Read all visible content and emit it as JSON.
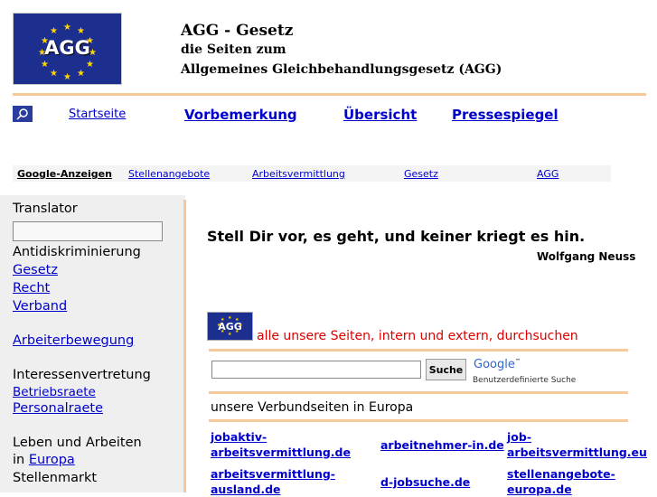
{
  "header": {
    "logo_text": "AGG",
    "title": "AGG - Gesetz",
    "subtitle1": "die Seiten zum",
    "subtitle2": "Allgemeines Gleichbehandlungsgesetz (AGG)"
  },
  "nav": {
    "home": "Startseite",
    "items": [
      "Vorbemerkung",
      "Übersicht",
      "Pressespiegel"
    ]
  },
  "ads": {
    "label": "Google-Anzeigen",
    "links": [
      "Stellenangebote",
      "Arbeitsvermittlung",
      "Gesetz",
      "AGG"
    ]
  },
  "sidebar": {
    "translator": "Translator",
    "antidisk": "Antidiskriminierung",
    "gesetz": "Gesetz",
    "recht": "Recht",
    "verband": "Verband",
    "arbeiter": "Arbeiterbewegung",
    "interessen": "Interessenvertretung",
    "betriebsraete": "Betriebsraete",
    "personalraete": "Personalraete",
    "leben": "Leben und Arbeiten",
    "in": "in",
    "europa": "Europa",
    "stellenmarkt": "Stellenmarkt"
  },
  "main": {
    "quote": "Stell Dir vor, es geht, und keiner kriegt es hin.",
    "author": "Wolfgang Neuss",
    "search_logo_text": "AGG",
    "search_heading": "alle unsere Seiten, intern und extern, durchsuchen",
    "search_button": "Suche",
    "search_value": "",
    "google_logo": "Google",
    "google_sub": "Benutzerdefinierte Suche",
    "euro_title": "unsere Verbundseiten in Europa",
    "euro_links": [
      "jobaktiv-\narbeitsvermittlung.de",
      "arbeitnehmer-in.de",
      "job-\narbeitsvermittlung.eu",
      "arbeitsvermittlung-\nausland.de",
      "d-jobsuche.de",
      "stellenangebote-\neuropa.de"
    ]
  },
  "colors": {
    "accent_rule": "#f5c99a",
    "logo_blue": "#1d2f8e",
    "link": "#0000cc",
    "heading_red": "#dd0000"
  }
}
